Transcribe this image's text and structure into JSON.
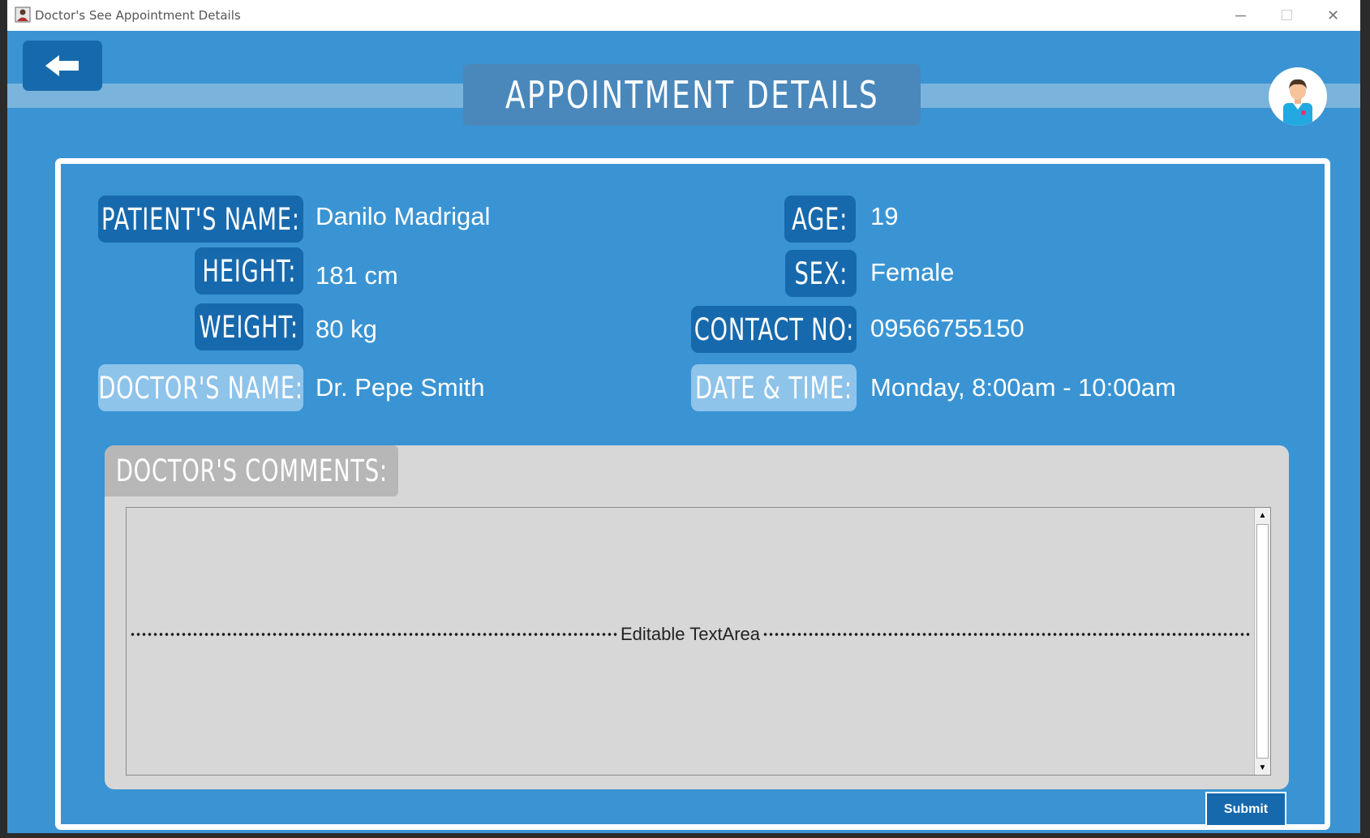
{
  "window": {
    "title": "Doctor's See Appointment Details",
    "minimize": "─",
    "maximize": "☐",
    "close": "✕"
  },
  "header": {
    "back_icon": "arrow-left-icon",
    "title": "APPOINTMENT DETAILS",
    "avatar_icon": "doctor-avatar-icon"
  },
  "patient": {
    "name_label": "PATIENT'S NAME:",
    "name": "Danilo Madrigal",
    "height_label": "HEIGHT:",
    "height": "181 cm",
    "weight_label": "WEIGHT:",
    "weight": "80 kg",
    "age_label": "AGE:",
    "age": "19",
    "sex_label": "SEX:",
    "sex": "Female",
    "contact_label": "CONTACT NO:",
    "contact": "09566755150"
  },
  "appointment": {
    "doctor_label": "DOCTOR'S NAME:",
    "doctor": "Dr. Pepe Smith",
    "datetime_label": "DATE & TIME:",
    "datetime": "Monday, 8:00am - 10:00am"
  },
  "comments": {
    "label": "DOCTOR'S COMMENTS:",
    "placeholder": "Editable TextArea",
    "scroll_up": "▲",
    "scroll_down": "▼"
  },
  "actions": {
    "submit": "Submit"
  },
  "colors": {
    "background": "#3a94d3",
    "label_dark": "#1769ad",
    "label_light": "#8ec3ea",
    "comments_bg": "#d7d7d7"
  }
}
